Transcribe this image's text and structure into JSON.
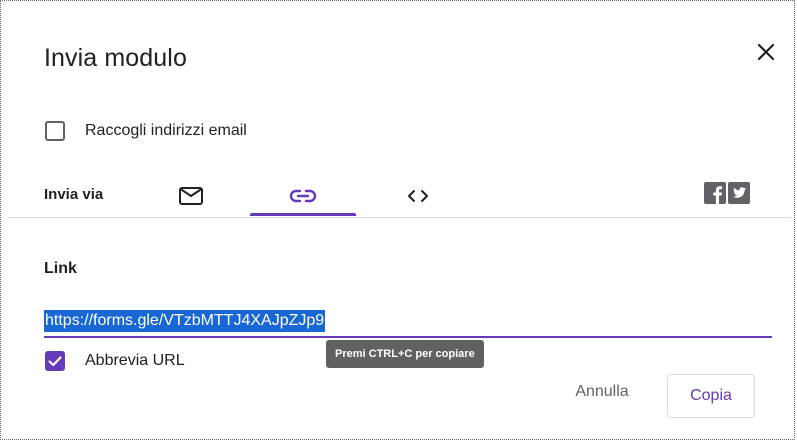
{
  "dialog": {
    "title": "Invia modulo",
    "close_icon": "close-icon"
  },
  "collect_emails": {
    "label": "Raccogli indirizzi email",
    "checked": false
  },
  "send_via": {
    "label": "Invia via",
    "tabs": [
      {
        "name": "email",
        "icon": "email-icon",
        "selected": false
      },
      {
        "name": "link",
        "icon": "link-icon",
        "selected": true
      },
      {
        "name": "embed",
        "icon": "embed-code-icon",
        "selected": false
      }
    ],
    "social": [
      "facebook-icon",
      "twitter-icon"
    ]
  },
  "link_section": {
    "label": "Link",
    "url": "https://forms.gle/VTzbMTTJ4XAJpZJp9"
  },
  "shorten_url": {
    "label": "Abbrevia URL",
    "checked": true
  },
  "tooltip": {
    "text": "Premi CTRL+C per copiare"
  },
  "actions": {
    "cancel_label": "Annulla",
    "copy_label": "Copia"
  },
  "colors": {
    "accent": "#673ab7",
    "selection": "#1967d2",
    "tooltip_bg": "#616161"
  }
}
